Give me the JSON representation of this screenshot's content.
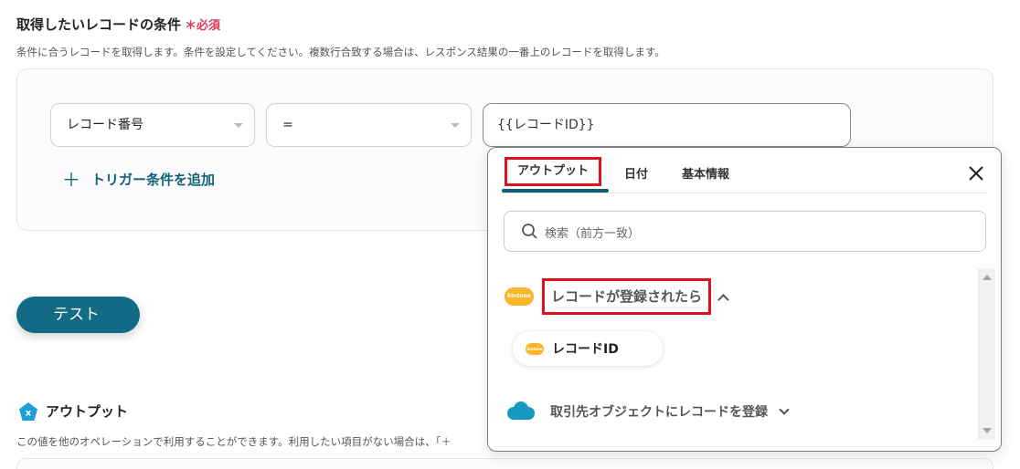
{
  "section": {
    "title": "取得したいレコードの条件",
    "required_mark": "＊必須",
    "description": "条件に合うレコードを取得します。条件を設定してください。複数行合致する場合は、レスポンス結果の一番上のレコードを取得します。"
  },
  "condition": {
    "field_select": "レコード番号",
    "operator_select": "=",
    "value": "{{レコードID}}",
    "add_trigger_label": "トリガー条件を追加"
  },
  "test_button": "テスト",
  "output": {
    "title": "アウトプット",
    "description": "この値を他のオペレーションで利用することができます。利用したい項目がない場合は、「＋"
  },
  "popup": {
    "tabs": [
      "アウトプット",
      "日付",
      "基本情報"
    ],
    "search_placeholder": "検索（前方一致）",
    "groups": [
      {
        "app": "kintone",
        "label": "レコードが登録されたら",
        "items": [
          {
            "label": "レコードID"
          }
        ]
      },
      {
        "app": "salesforce",
        "label": "取引先オブジェクトにレコードを登録"
      }
    ]
  },
  "colors": {
    "accent": "#115e78",
    "button": "#126a84",
    "required": "#e0395a",
    "highlight": "#e0101f",
    "kintone": "#f8b62a",
    "salesforce": "#1798c1",
    "output_icon": "#1e9fd8"
  }
}
